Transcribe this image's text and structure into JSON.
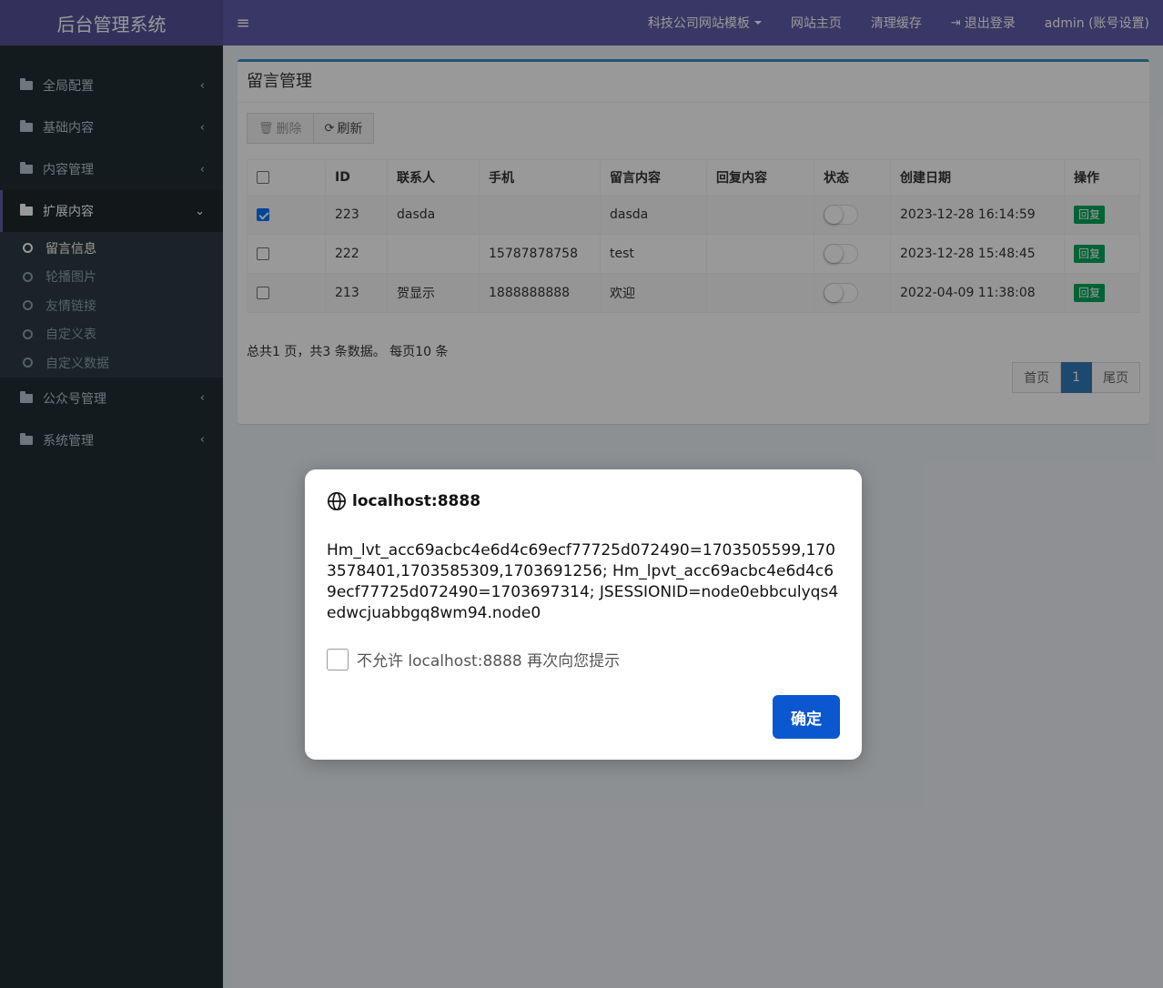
{
  "header": {
    "logo": "后台管理系统",
    "toggle_icon": "bars-icon",
    "nav": {
      "template": "科技公司网站模板",
      "home": "网站主页",
      "clear_cache": "清理缓存",
      "logout": "退出登录",
      "account": "admin (账号设置)"
    }
  },
  "sidebar": {
    "items": [
      {
        "label": "全局配置"
      },
      {
        "label": "基础内容"
      },
      {
        "label": "内容管理"
      },
      {
        "label": "扩展内容"
      },
      {
        "label": "公众号管理"
      },
      {
        "label": "系统管理"
      }
    ],
    "sub_items": [
      {
        "label": "留言信息"
      },
      {
        "label": "轮播图片"
      },
      {
        "label": "友情链接"
      },
      {
        "label": "自定义表"
      },
      {
        "label": "自定义数据"
      }
    ]
  },
  "main": {
    "title": "留言管理",
    "toolbar": {
      "delete": "删除",
      "refresh": "刷新"
    },
    "table": {
      "headers": [
        "ID",
        "联系人",
        "手机",
        "留言内容",
        "回复内容",
        "状态",
        "创建日期",
        "操作"
      ],
      "rows": [
        {
          "checked": true,
          "id": "223",
          "contact": "dasda",
          "phone": "",
          "content": "dasda",
          "reply": "",
          "status": "off",
          "date": "2023-12-28 16:14:59",
          "action": "回复"
        },
        {
          "checked": false,
          "id": "222",
          "contact": "",
          "phone": "15787878758",
          "content": "test",
          "reply": "",
          "status": "off",
          "date": "2023-12-28 15:48:45",
          "action": "回复"
        },
        {
          "checked": false,
          "id": "213",
          "contact": "贺显示",
          "phone": "1888888888",
          "content": "欢迎",
          "reply": "",
          "status": "off",
          "date": "2022-04-09 11:38:08",
          "action": "回复"
        }
      ]
    },
    "page_info": "总共1 页，共3 条数据。 每页10 条",
    "pagination": {
      "first": "首页",
      "current": "1",
      "last": "尾页"
    }
  },
  "dialog": {
    "origin": "localhost:8888",
    "origin_icon": "globe-icon",
    "message": "Hm_lvt_acc69acbc4e6d4c69ecf77725d072490=1703505599,1703578401,1703585309,1703691256; Hm_lpvt_acc69acbc4e6d4c69ecf77725d072490=1703697314; JSESSIONID=node0ebbculyqs4edwcjuabbgq8wm94.node0",
    "suppress_label": "不允许 localhost:8888 再次向您提示",
    "ok": "确定"
  },
  "colors": {
    "header": "#605ca8",
    "sidebar": "#222d32",
    "box_accent": "#3c8dbc",
    "reply_button": "#00a65a",
    "page_active": "#337ab7",
    "dialog_ok": "#0b57d0"
  }
}
